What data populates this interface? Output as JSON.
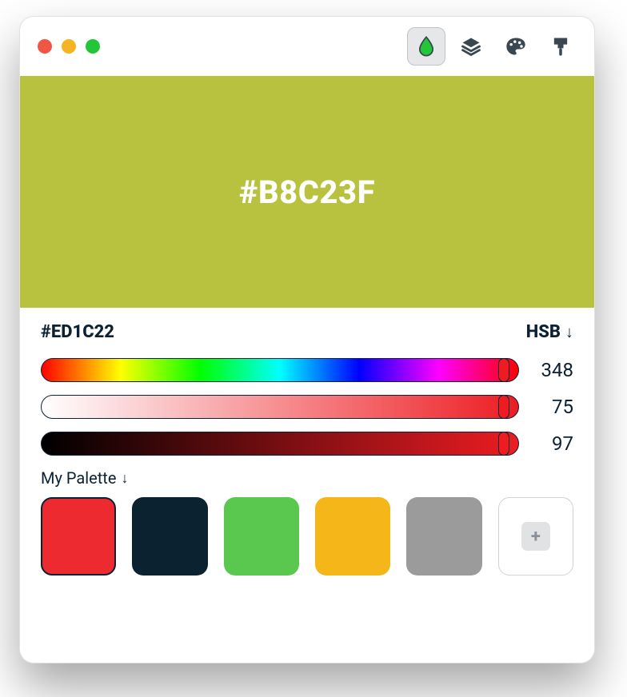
{
  "preview": {
    "hex": "#B8C23F",
    "bg": "#B8C23F"
  },
  "picker": {
    "hex": "#ED1C22",
    "mode": "HSB",
    "hue": {
      "value": 348,
      "percent": 97
    },
    "sat": {
      "value": 75,
      "percent": 97
    },
    "bri": {
      "value": 97,
      "percent": 97
    }
  },
  "palette": {
    "label": "My Palette",
    "swatches": [
      {
        "color": "#ED2A2F",
        "selected": true
      },
      {
        "color": "#0B2231",
        "selected": false
      },
      {
        "color": "#5AC84F",
        "selected": false
      },
      {
        "color": "#F4B619",
        "selected": false
      },
      {
        "color": "#9B9B9B",
        "selected": false
      }
    ]
  },
  "icons": {
    "plus": "+"
  }
}
